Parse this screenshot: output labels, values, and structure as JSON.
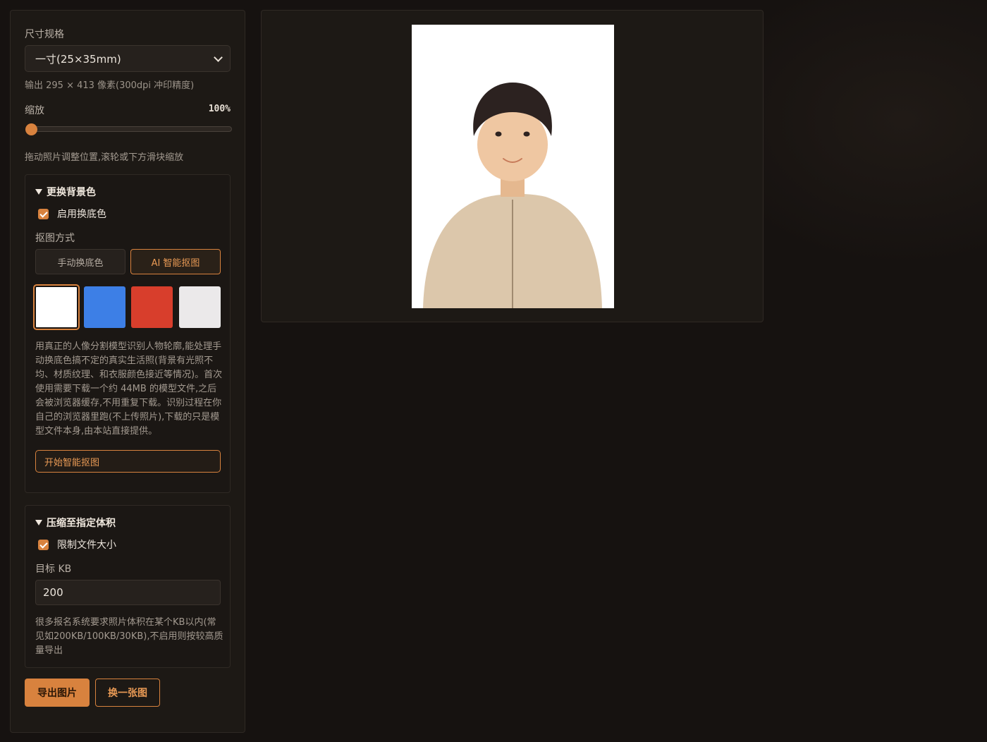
{
  "size": {
    "label": "尺寸规格",
    "selected": "一寸(25×35mm)",
    "output_info": "输出 295 × 413 像素(300dpi 冲印精度)"
  },
  "zoom": {
    "label": "缩放",
    "value_text": "100%",
    "level_percent": 100,
    "hint": "拖动照片调整位置,滚轮或下方滑块缩放"
  },
  "background_section": {
    "title": "更换背景色",
    "enable_label": "启用换底色",
    "enabled": true,
    "method_label": "抠图方式",
    "methods": [
      "手动换底色",
      "AI 智能抠图"
    ],
    "selected_method": "AI 智能抠图",
    "swatches": [
      {
        "name": "white",
        "color": "#ffffff",
        "selected": true
      },
      {
        "name": "blue",
        "color": "#3d7fe6",
        "selected": false
      },
      {
        "name": "red",
        "color": "#d83e2c",
        "selected": false
      },
      {
        "name": "light-gray",
        "color": "#ebe9ea",
        "selected": false
      }
    ],
    "description": "用真正的人像分割模型识别人物轮廓,能处理手动换底色搞不定的真实生活照(背景有光照不均、材质纹理、和衣服颜色接近等情况)。首次使用需要下载一个约 44MB 的模型文件,之后会被浏览器缓存,不用重复下载。识别过程在你自己的浏览器里跑(不上传照片),下载的只是模型文件本身,由本站直接提供。",
    "start_button": "开始智能抠图"
  },
  "compress_section": {
    "title": "压缩至指定体积",
    "limit_label": "限制文件大小",
    "enabled": true,
    "target_label": "目标 KB",
    "target_value": "200",
    "description": "很多报名系统要求照片体积在某个KB以内(常见如200KB/100KB/30KB),不启用则按较高质量导出"
  },
  "actions": {
    "export": "导出图片",
    "change": "换一张图"
  },
  "colors": {
    "accent": "#d8823e",
    "background": "#161210",
    "panel": "#1d1915"
  }
}
